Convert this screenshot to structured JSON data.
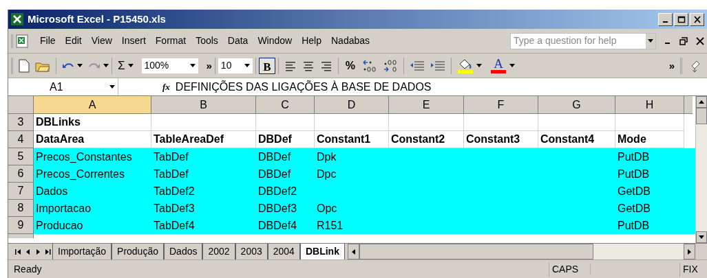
{
  "window": {
    "title": "Microsoft Excel - P15450.xls"
  },
  "menu": [
    {
      "label": "File"
    },
    {
      "label": "Edit"
    },
    {
      "label": "View"
    },
    {
      "label": "Insert"
    },
    {
      "label": "Format"
    },
    {
      "label": "Tools"
    },
    {
      "label": "Data"
    },
    {
      "label": "Window"
    },
    {
      "label": "Help"
    },
    {
      "label": "Nadabas"
    }
  ],
  "help_search": {
    "placeholder": "Type a question for help"
  },
  "toolbar": {
    "sum": "Σ",
    "zoom": "100%",
    "more": "»",
    "font_size": "10",
    "bold": "B",
    "percent": "%",
    "font_color": "A",
    "more_2": "»",
    "bold_on": true
  },
  "formula_bar": {
    "name_box": "A1",
    "fx": "fx",
    "value": "DEFINIÇÕES DAS LIGAÇÕES À BASE DE DADOS"
  },
  "columns": [
    {
      "label": "A",
      "selected": true
    },
    {
      "label": "B",
      "selected": false
    },
    {
      "label": "C",
      "selected": false
    },
    {
      "label": "D",
      "selected": false
    },
    {
      "label": "E",
      "selected": false
    },
    {
      "label": "F",
      "selected": false
    },
    {
      "label": "G",
      "selected": false
    },
    {
      "label": "H",
      "selected": false
    }
  ],
  "rows": [
    {
      "number": "3",
      "highlighted": false,
      "bold": true,
      "cells": [
        "DBLinks",
        "",
        "",
        "",
        "",
        "",
        "",
        ""
      ]
    },
    {
      "number": "4",
      "highlighted": false,
      "bold": true,
      "cells": [
        "DataArea",
        "TableAreaDef",
        "DBDef",
        "Constant1",
        "Constant2",
        "Constant3",
        "Constant4",
        "Mode"
      ]
    },
    {
      "number": "5",
      "highlighted": true,
      "bold": false,
      "cells": [
        "Precos_Constantes",
        "TabDef",
        "DBDef",
        "Dpk",
        "",
        "",
        "",
        "PutDB"
      ]
    },
    {
      "number": "6",
      "highlighted": true,
      "bold": false,
      "cells": [
        "Precos_Correntes",
        "TabDef",
        "DBDef",
        "Dpc",
        "",
        "",
        "",
        "PutDB"
      ]
    },
    {
      "number": "7",
      "highlighted": true,
      "bold": false,
      "cells": [
        "Dados",
        "TabDef2",
        "DBDef2",
        "",
        "",
        "",
        "",
        "GetDB"
      ]
    },
    {
      "number": "8",
      "highlighted": true,
      "bold": false,
      "cells": [
        "Importacao",
        "TabDef3",
        "DBDef3",
        "Opc",
        "",
        "",
        "",
        "GetDB"
      ]
    },
    {
      "number": "9",
      "highlighted": true,
      "bold": false,
      "cells": [
        "Producao",
        "TabDef4",
        "DBDef4",
        "R151",
        "",
        "",
        "",
        "PutDB"
      ]
    }
  ],
  "sheet_tabs": [
    {
      "label": "Importação",
      "selected": false
    },
    {
      "label": "Produção",
      "selected": false
    },
    {
      "label": "Dados",
      "selected": false
    },
    {
      "label": "2002",
      "selected": false
    },
    {
      "label": "2003",
      "selected": false
    },
    {
      "label": "2004",
      "selected": false
    },
    {
      "label": "DBLink",
      "selected": true
    }
  ],
  "status_bar": {
    "status": "Ready",
    "caps": "CAPS",
    "fix": "FIX"
  }
}
